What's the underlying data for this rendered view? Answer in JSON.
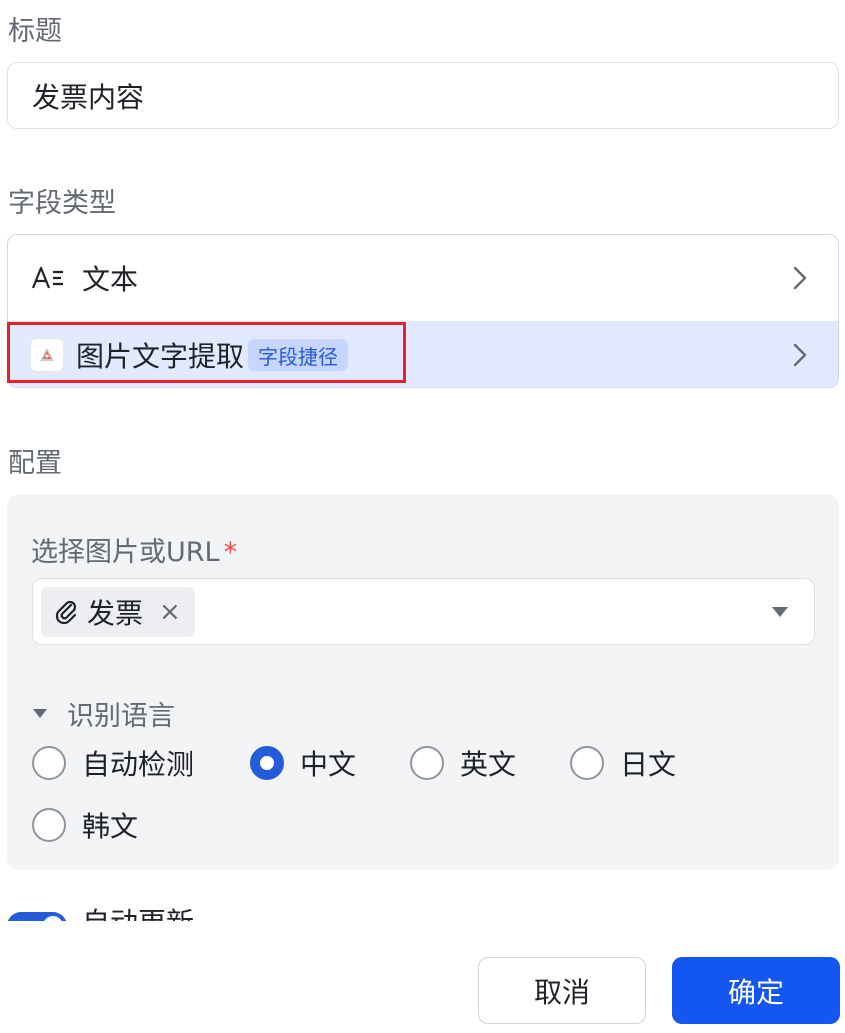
{
  "title_section": {
    "label": "标题",
    "value": "发票内容"
  },
  "field_type": {
    "label": "字段类型",
    "options": [
      {
        "icon": "text-type-icon",
        "label": "文本"
      },
      {
        "icon": "image-ocr-icon",
        "label": "图片文字提取",
        "badge": "字段捷径"
      }
    ]
  },
  "config": {
    "label": "配置",
    "source_label": "选择图片或URL",
    "required_mark": "*",
    "selected_tag": {
      "icon": "paperclip-icon",
      "text": "发票",
      "close": "×"
    },
    "language": {
      "title": "识别语言",
      "options": [
        "自动检测",
        "中文",
        "英文",
        "日文",
        "韩文"
      ],
      "selected": "中文"
    }
  },
  "auto_update": {
    "label": "自动更新",
    "enabled": true
  },
  "footer": {
    "cancel_label": "取消",
    "confirm_label": "确定"
  },
  "colors": {
    "primary": "#1456f0",
    "selected_row": "#e1eaff",
    "highlight_border": "#e5202b",
    "required": "#f54a45"
  }
}
